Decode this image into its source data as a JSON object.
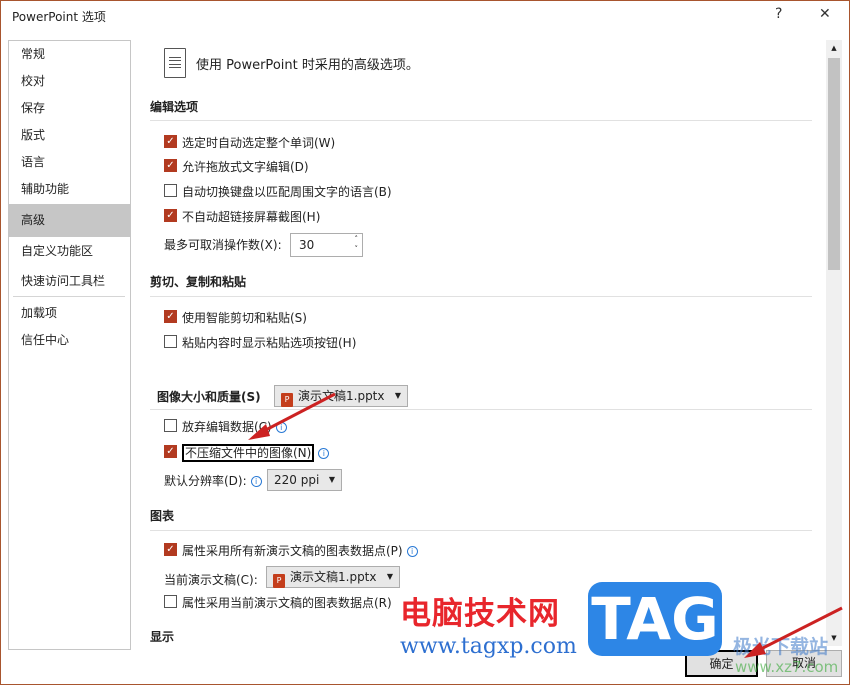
{
  "window": {
    "title": "PowerPoint 选项",
    "help": "?",
    "close": "✕"
  },
  "sidebar": {
    "items": [
      {
        "label": "常规"
      },
      {
        "label": "校对"
      },
      {
        "label": "保存"
      },
      {
        "label": "版式"
      },
      {
        "label": "语言"
      },
      {
        "label": "辅助功能"
      },
      {
        "label": "高级",
        "selected": true
      },
      {
        "label": "自定义功能区"
      },
      {
        "label": "快速访问工具栏"
      },
      {
        "label": "加载项"
      },
      {
        "label": "信任中心"
      }
    ]
  },
  "main": {
    "intro": "使用 PowerPoint 时采用的高级选项。",
    "editing": {
      "header": "编辑选项",
      "options": [
        {
          "label": "选定时自动选定整个单词(W)",
          "checked": true
        },
        {
          "label": "允许拖放式文字编辑(D)",
          "checked": true
        },
        {
          "label": "自动切换键盘以匹配周围文字的语言(B)",
          "checked": false
        },
        {
          "label": "不自动超链接屏幕截图(H)",
          "checked": true
        }
      ],
      "undo_label": "最多可取消操作数(X):",
      "undo_value": "30"
    },
    "clipboard": {
      "header": "剪切、复制和粘贴",
      "options": [
        {
          "label": "使用智能剪切和粘贴(S)",
          "checked": true
        },
        {
          "label": "粘贴内容时显示粘贴选项按钮(H)",
          "checked": false
        }
      ]
    },
    "image": {
      "header": "图像大小和质量(S)",
      "file": "演示文稿1.pptx",
      "options": [
        {
          "label": "放弃编辑数据(C)",
          "checked": false
        },
        {
          "label": "不压缩文件中的图像(N)",
          "checked": true
        }
      ],
      "resolution_label": "默认分辨率(D):",
      "resolution_value": "220 ppi"
    },
    "chart": {
      "header": "图表",
      "opt1": "属性采用所有新演示文稿的图表数据点(P)",
      "opt1_checked": true,
      "current_label": "当前演示文稿(C):",
      "file": "演示文稿1.pptx",
      "opt2": "属性采用当前演示文稿的图表数据点(R)",
      "opt2_checked": false
    },
    "display": {
      "header": "显示"
    }
  },
  "buttons": {
    "ok": "确定",
    "cancel": "取消"
  },
  "watermark": {
    "site_name": "电脑技术网",
    "site_url": "www.tagxp.com",
    "logo": "TAG",
    "site2": "极光下载站",
    "site2_url": "www.xz7.com"
  },
  "colors": {
    "accent": "#b23a20",
    "arrow": "#cc2222"
  }
}
